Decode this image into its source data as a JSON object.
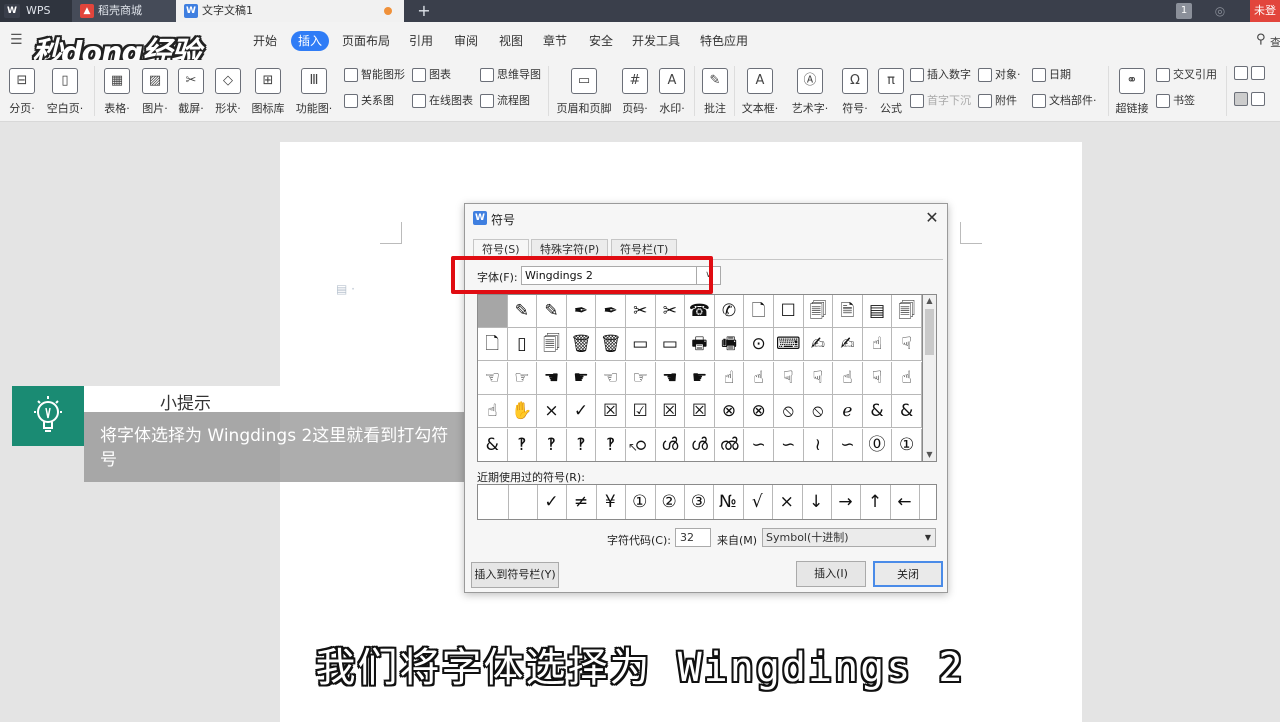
{
  "tabbar": {
    "tabs": [
      {
        "label": "WPS",
        "icon": "wps-logo-icon"
      },
      {
        "label": "稻壳商城",
        "icon": "docer-store-icon"
      },
      {
        "label": "文字文稿1",
        "icon": "writer-document-icon"
      }
    ],
    "add_tab": "+",
    "login_label": "未登"
  },
  "menu": {
    "items": [
      "开始",
      "插入",
      "页面布局",
      "引用",
      "审阅",
      "视图",
      "章节",
      "安全",
      "开发工具",
      "特色应用"
    ],
    "active": "插入",
    "search_text": "查"
  },
  "logo_text": "秒dong经验",
  "ribbon": {
    "large": [
      {
        "label": "分页·",
        "icon": "page-break-icon"
      },
      {
        "label": "空白页·",
        "icon": "blank-page-icon"
      },
      {
        "label": "表格·",
        "icon": "table-icon"
      },
      {
        "label": "图片·",
        "icon": "picture-icon"
      },
      {
        "label": "截屏·",
        "icon": "screenshot-icon"
      },
      {
        "label": "形状·",
        "icon": "shapes-icon"
      },
      {
        "label": "图标库",
        "icon": "icon-library-icon"
      },
      {
        "label": "功能图·",
        "icon": "function-chart-icon"
      },
      {
        "label": "页眉和页脚",
        "icon": "header-footer-icon"
      },
      {
        "label": "页码·",
        "icon": "page-number-icon"
      },
      {
        "label": "水印·",
        "icon": "watermark-icon"
      },
      {
        "label": "批注",
        "icon": "comment-icon"
      },
      {
        "label": "文本框·",
        "icon": "textbox-icon"
      },
      {
        "label": "艺术字·",
        "icon": "wordart-icon"
      },
      {
        "label": "符号·",
        "icon": "omega-symbol-icon"
      },
      {
        "label": "公式",
        "icon": "pi-formula-icon"
      },
      {
        "label": "超链接",
        "icon": "hyperlink-icon"
      }
    ],
    "small": [
      {
        "label": "智能图形",
        "icon": "smart-graphic-icon"
      },
      {
        "label": "关系图",
        "icon": "relation-chart-icon"
      },
      {
        "label": "图表",
        "icon": "chart-icon"
      },
      {
        "label": "在线图表",
        "icon": "online-chart-icon"
      },
      {
        "label": "思维导图",
        "icon": "mind-map-icon"
      },
      {
        "label": "流程图",
        "icon": "flowchart-icon"
      },
      {
        "label": "插入数字",
        "icon": "insert-number-icon"
      },
      {
        "label": "首字下沉",
        "icon": "drop-cap-icon"
      },
      {
        "label": "对象·",
        "icon": "object-icon"
      },
      {
        "label": "附件",
        "icon": "attachment-icon"
      },
      {
        "label": "日期",
        "icon": "date-icon"
      },
      {
        "label": "文档部件·",
        "icon": "doc-parts-icon"
      },
      {
        "label": "交叉引用",
        "icon": "cross-reference-icon"
      },
      {
        "label": "书签",
        "icon": "bookmark-icon"
      }
    ]
  },
  "tip": {
    "title": "小提示",
    "text": "将字体选择为 Wingdings 2这里就看到打勾符号"
  },
  "dialog": {
    "title": "符号",
    "tabs": [
      "符号(S)",
      "特殊字符(P)",
      "符号栏(T)"
    ],
    "font_label": "字体(F):",
    "font_value": "Wingdings 2",
    "symbol_rows": [
      [
        "",
        "✎",
        "✎",
        "✒",
        "✒",
        "✂",
        "✂",
        "☎",
        "✆",
        "🗋",
        "☐",
        "🗐",
        "🗎",
        "▤",
        "🗐"
      ],
      [
        "🗋",
        "▯",
        "🗐",
        "🗑",
        "🗑",
        "▭",
        "▭",
        "🖶",
        "🖷",
        "⊙",
        "⌨",
        "✍",
        "✍",
        "☝",
        "☟"
      ],
      [
        "☜",
        "☞",
        "☚",
        "☛",
        "☜",
        "☞",
        "☚",
        "☛",
        "☝",
        "☝",
        "☟",
        "☟",
        "☝",
        "☟",
        "☝"
      ],
      [
        "☝",
        "✋",
        "×",
        "✓",
        "☒",
        "☑",
        "☒",
        "☒",
        "⊗",
        "⊗",
        "⦸",
        "⦸",
        "ℯ",
        "&",
        "&"
      ],
      [
        "&",
        "‽",
        "‽",
        "‽",
        "‽",
        "ഠ",
        "ൾ",
        "ൾ",
        "ൽ",
        "∽",
        "∽",
        "≀",
        "∽",
        "⓪",
        "①"
      ]
    ],
    "recent_label": "近期使用过的符号(R):",
    "recent": [
      "",
      "",
      "✓",
      "≠",
      "¥",
      "①",
      "②",
      "③",
      "№",
      "√",
      "×",
      "↓",
      "→",
      "↑",
      "←"
    ],
    "code_label": "字符代码(C):",
    "code_value": "32",
    "from_label": "来自(M)",
    "from_value": "Symbol(十进制)",
    "btn_insert_bar": "插入到符号栏(Y)",
    "btn_insert": "插入(I)",
    "btn_close": "关闭"
  },
  "subtitle": "我们将字体选择为 Wingdings 2"
}
